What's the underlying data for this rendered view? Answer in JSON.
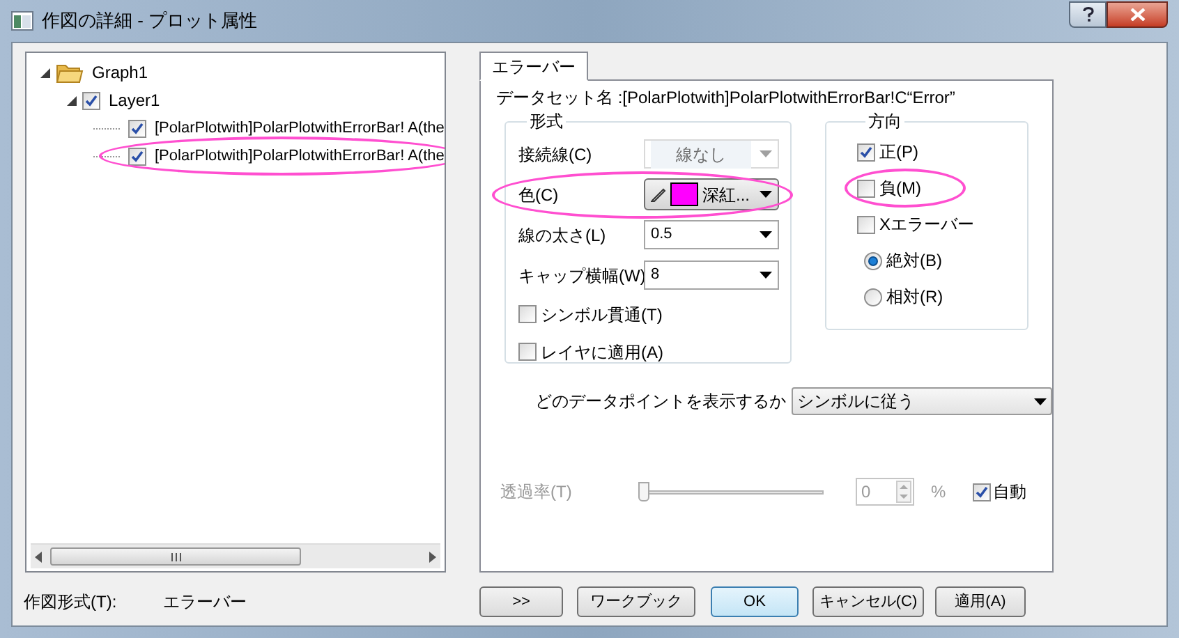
{
  "window": {
    "title": "作図の詳細 - プロット属性"
  },
  "tree": [
    {
      "label": "Graph1",
      "kind": "folder",
      "expanded": true,
      "children": [
        {
          "label": "Layer1",
          "kind": "layer",
          "checked": true,
          "expanded": true,
          "children": [
            {
              "label": "[PolarPlotwith]PolarPlotwithErrorBar!  A(the",
              "kind": "plot",
              "checked": true,
              "circled": false
            },
            {
              "label": "[PolarPlotwith]PolarPlotwithErrorBar!  A(the",
              "kind": "plot",
              "checked": true,
              "circled": true
            }
          ]
        }
      ]
    }
  ],
  "plot_type": {
    "label": "作図形式(T):",
    "value": "エラーバー"
  },
  "tabs": [
    {
      "label": "エラーバー",
      "selected": true
    }
  ],
  "dataset_name": "データセット名 :[PolarPlotwith]PolarPlotwithErrorBar!C“Error”",
  "format_group": {
    "title": "形式",
    "rows": [
      {
        "kind": "dropdown",
        "label": "接続線(C)",
        "value": "線なし",
        "disabled": true,
        "circled": false
      },
      {
        "kind": "color",
        "label": "色(C)",
        "value": "深紅...",
        "color": "#ff00ff",
        "circled": true
      },
      {
        "kind": "dropdown",
        "label": "線の太さ(L)",
        "value": "0.5",
        "disabled": false,
        "circled": false
      },
      {
        "kind": "dropdown",
        "label": "キャップ横幅(W)",
        "value": "8",
        "disabled": false,
        "circled": false
      },
      {
        "kind": "checkbox",
        "label": "シンボル貫通(T)",
        "checked": false,
        "circled": false
      },
      {
        "kind": "checkbox",
        "label": "レイヤに適用(A)",
        "checked": false,
        "circled": false
      }
    ]
  },
  "direction_group": {
    "title": "方向",
    "items": [
      {
        "kind": "checkbox",
        "label": "正(P)",
        "checked": true,
        "circled": false
      },
      {
        "kind": "checkbox",
        "label": "負(M)",
        "checked": false,
        "circled": true
      },
      {
        "kind": "checkbox",
        "label": "Xエラーバー",
        "checked": false,
        "circled": false
      },
      {
        "kind": "radio",
        "label": "絶対(B)",
        "selected": true
      },
      {
        "kind": "radio",
        "label": "相対(R)",
        "selected": false
      }
    ]
  },
  "data_points": {
    "label": "どのデータポイントを表示するか",
    "value": "シンボルに従う"
  },
  "transparency": {
    "label": "透過率(T)",
    "level": 0,
    "value": "0",
    "unit": "%",
    "disabled": true,
    "auto": {
      "label": "自動",
      "checked": true
    }
  },
  "buttons": [
    {
      "label": ">>",
      "default": false
    },
    {
      "label": "ワークブック",
      "default": false
    },
    {
      "label": "OK",
      "default": true
    },
    {
      "label": "キャンセル(C)",
      "default": false
    },
    {
      "label": "適用(A)",
      "default": false
    }
  ]
}
